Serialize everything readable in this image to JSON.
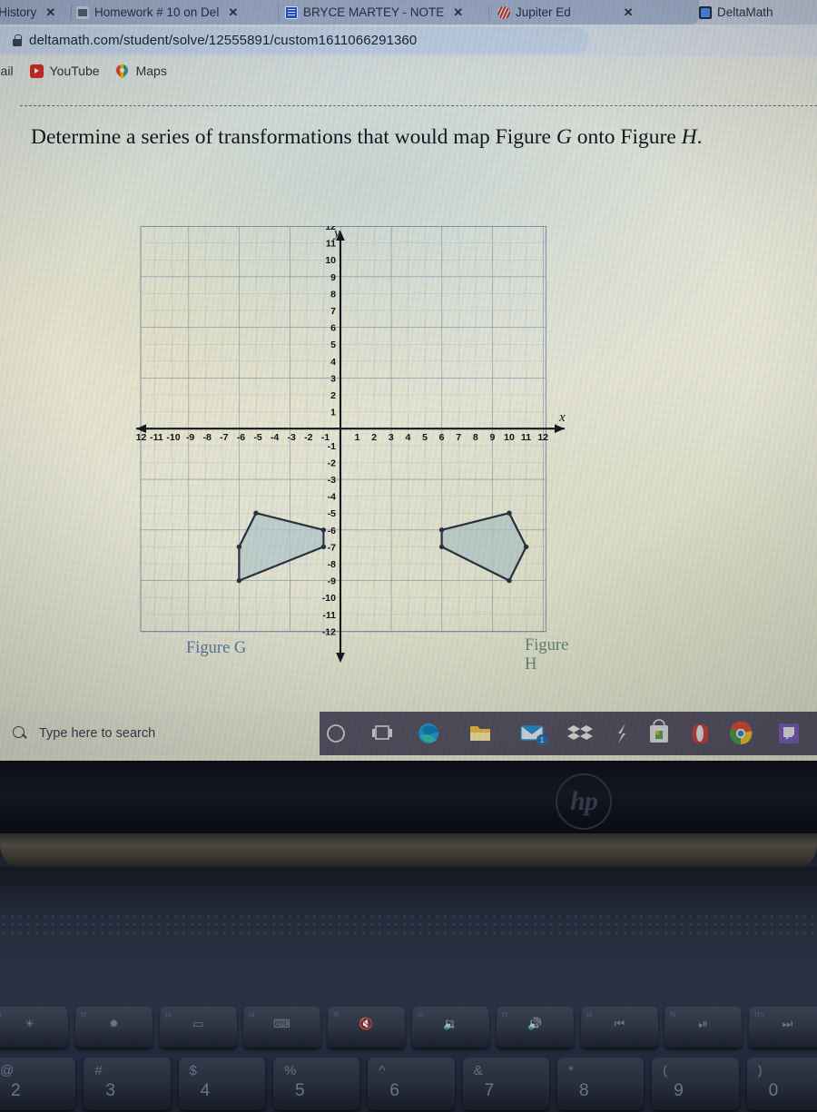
{
  "browser": {
    "tabs": [
      {
        "title": "al History",
        "favicon": "history-icon",
        "closable": true
      },
      {
        "title": "Homework # 10 on Del",
        "favicon": "note-icon",
        "closable": true
      },
      {
        "title": "BRYCE MARTEY - NOTE",
        "favicon": "google-docs-icon",
        "closable": true
      },
      {
        "title": "Jupiter Ed",
        "favicon": "jupiter-ed-icon",
        "closable": true
      },
      {
        "title": "DeltaMath",
        "favicon": "deltamath-icon",
        "closable": false
      }
    ],
    "close_glyph": "✕",
    "address": {
      "url": "deltamath.com/student/solve/12555891/custom1611066291360",
      "security_icon": "lock-icon"
    },
    "bookmarks": [
      {
        "label": "Gmail",
        "icon": "gmail-icon"
      },
      {
        "label": "YouTube",
        "icon": "youtube-icon"
      },
      {
        "label": "Maps",
        "icon": "google-maps-icon"
      }
    ]
  },
  "question": {
    "prefix": "Determine a series of transformations that would map Figure ",
    "figure_a": "G",
    "middle": " onto Figure ",
    "figure_b": "H",
    "suffix": "."
  },
  "graph": {
    "x_axis_label": "x",
    "y_axis_label": "y",
    "x_ticks_negative": [
      "-12",
      "-11",
      "-10",
      "-9",
      "-8",
      "-7",
      "-6",
      "-5",
      "-4",
      "-3",
      "-2",
      "-1"
    ],
    "x_ticks_positive": [
      "1",
      "2",
      "3",
      "4",
      "5",
      "6",
      "7",
      "8",
      "9",
      "10",
      "11",
      "12"
    ],
    "y_ticks_positive": [
      "12",
      "11",
      "10",
      "9",
      "8",
      "7",
      "6",
      "5",
      "4",
      "3",
      "2",
      "1"
    ],
    "y_ticks_negative": [
      "-1",
      "-2",
      "-3",
      "-4",
      "-5",
      "-6",
      "-7",
      "-8",
      "-9",
      "-10",
      "-11",
      "-12"
    ],
    "figure_g_label": "Figure G",
    "figure_h_label": "Figure H",
    "grid_color": "#9aa8c4",
    "axis_color": "#15181f",
    "polygon_fill": "#b9cdd4",
    "polygon_stroke": "#2b3244"
  },
  "chart_data": {
    "type": "scatter",
    "title": "",
    "xlabel": "x",
    "ylabel": "y",
    "xlim": [
      -12,
      12
    ],
    "ylim": [
      -12,
      12
    ],
    "grid": true,
    "legend": "none",
    "series": [
      {
        "name": "Figure G",
        "label_color": "#5c7ea8",
        "vertices": [
          [
            -5,
            -5
          ],
          [
            -1,
            -6
          ],
          [
            -1,
            -7
          ],
          [
            -6,
            -9
          ],
          [
            -6,
            -7
          ]
        ]
      },
      {
        "name": "Figure H",
        "label_color": "#6d8c7d",
        "vertices": [
          [
            10,
            -5
          ],
          [
            11,
            -7
          ],
          [
            10,
            -9
          ],
          [
            6,
            -7
          ],
          [
            6,
            -6
          ]
        ]
      }
    ]
  },
  "taskbar": {
    "search_placeholder": "Type here to search",
    "search_icon": "search-icon",
    "icons": [
      {
        "name": "cortana-icon"
      },
      {
        "name": "task-view-icon"
      },
      {
        "name": "microsoft-edge-icon"
      },
      {
        "name": "file-explorer-icon"
      },
      {
        "name": "mail-icon",
        "badge": "1"
      },
      {
        "name": "dropbox-icon"
      },
      {
        "name": "lightning-icon"
      },
      {
        "name": "store-icon"
      },
      {
        "name": "opera-icon"
      },
      {
        "name": "chrome-icon"
      },
      {
        "name": "twitch-icon"
      }
    ]
  },
  "laptop": {
    "brand": "hp",
    "function_keys": [
      {
        "fn": "f1",
        "glyph": "☀"
      },
      {
        "fn": "f2",
        "glyph": "✹"
      },
      {
        "fn": "f3",
        "glyph": "▭"
      },
      {
        "fn": "f4",
        "glyph": "⌨"
      },
      {
        "fn": "f5",
        "glyph": "🔇"
      },
      {
        "fn": "f6",
        "glyph": "🔉"
      },
      {
        "fn": "f7",
        "glyph": "🔊"
      },
      {
        "fn": "f8",
        "glyph": "⏮"
      },
      {
        "fn": "f9",
        "glyph": "⏯"
      },
      {
        "fn": "f10",
        "glyph": "⏭"
      }
    ],
    "number_keys": [
      {
        "symbol": "@",
        "number": "2"
      },
      {
        "symbol": "#",
        "number": "3"
      },
      {
        "symbol": "$",
        "number": "4"
      },
      {
        "symbol": "%",
        "number": "5"
      },
      {
        "symbol": "^",
        "number": "6"
      },
      {
        "symbol": "&",
        "number": "7"
      },
      {
        "symbol": "*",
        "number": "8"
      },
      {
        "symbol": "(",
        "number": "9"
      },
      {
        "symbol": ")",
        "number": "0"
      }
    ]
  }
}
